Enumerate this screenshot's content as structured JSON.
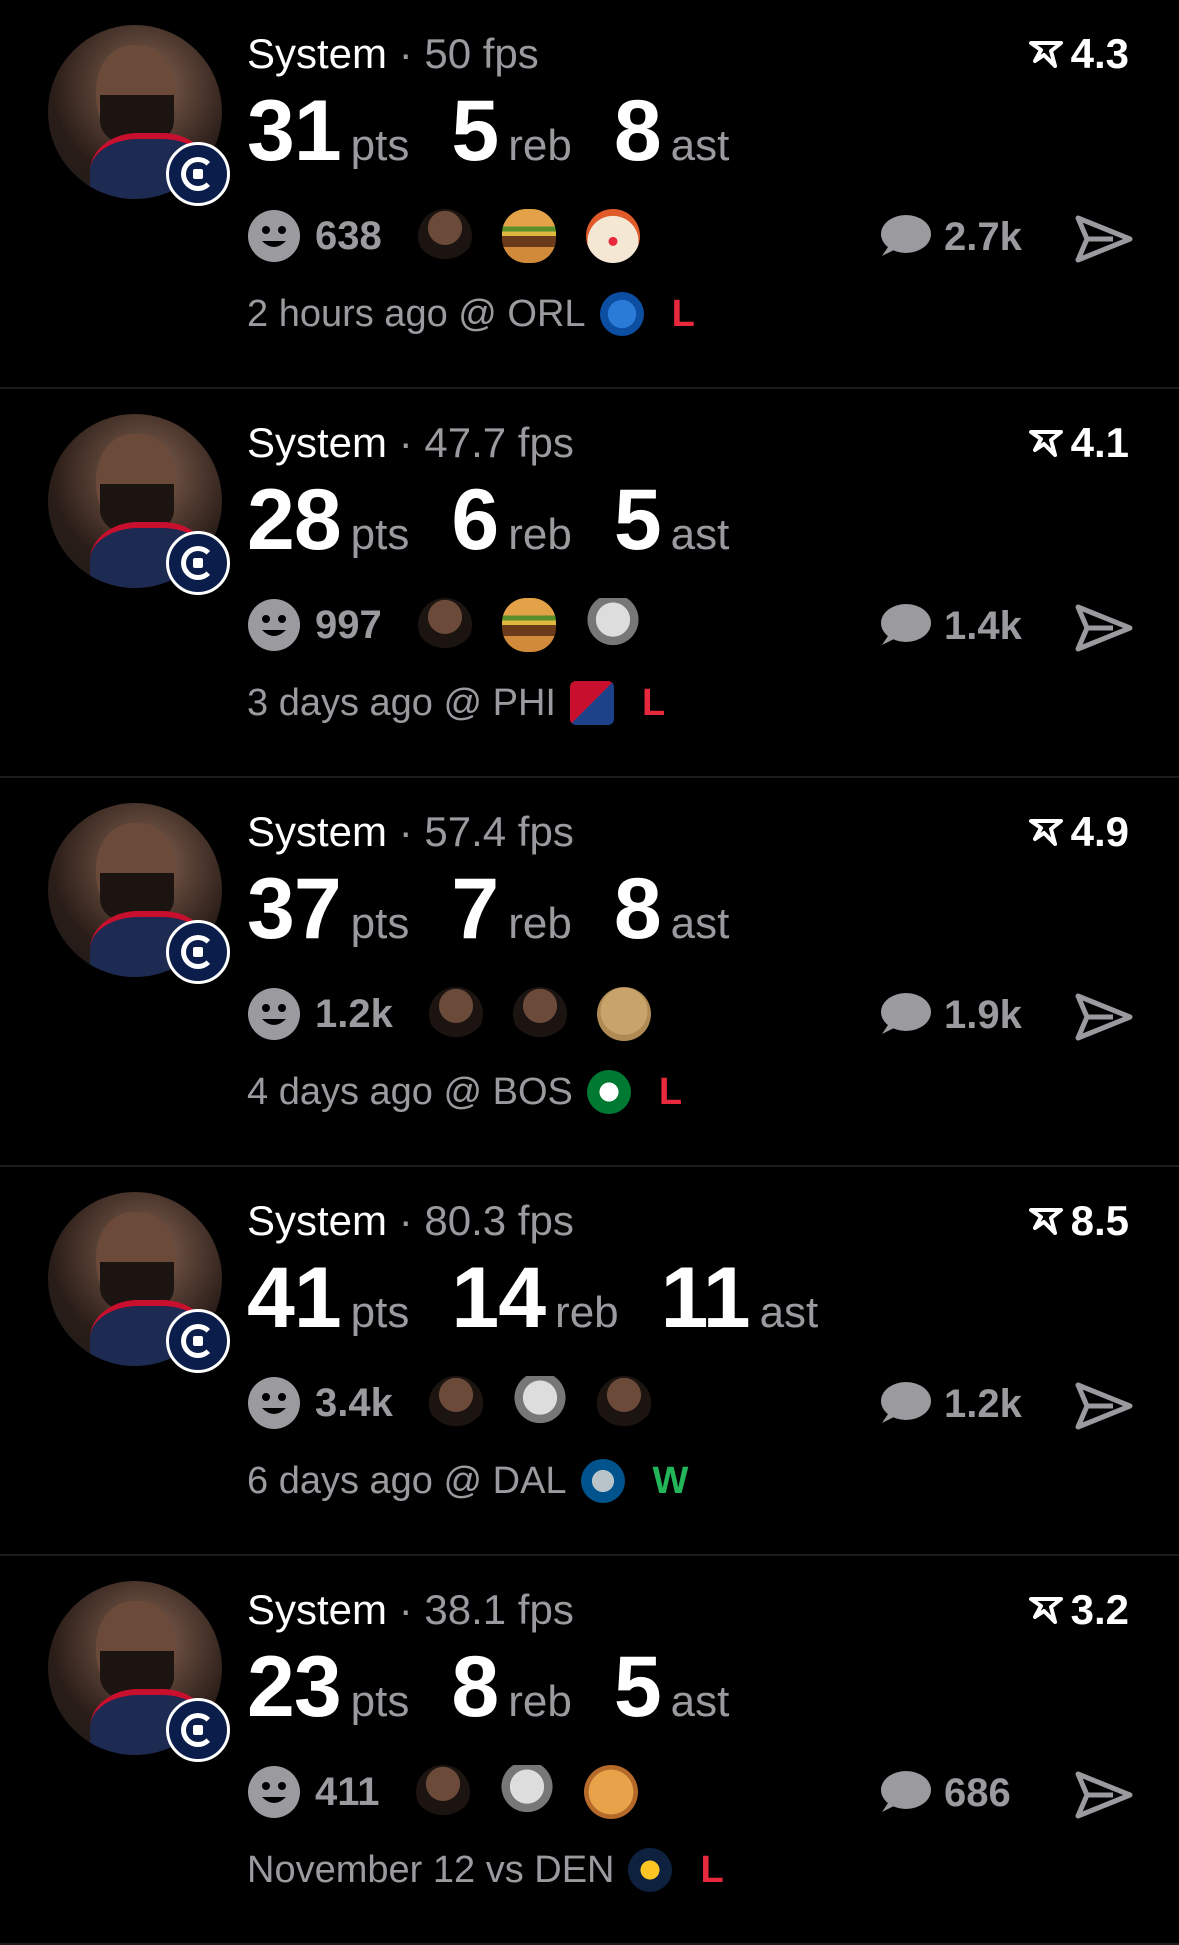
{
  "colors": {
    "background": "#000000",
    "primary_text": "#ffffff",
    "secondary_text": "#9a9a9f",
    "loss": "#e8283c",
    "win": "#22b559"
  },
  "posts": [
    {
      "author": "System",
      "separator": "·",
      "fps": "50 fps",
      "rating": "4.3",
      "stats": [
        {
          "value": "31",
          "unit": "pts"
        },
        {
          "value": "5",
          "unit": "reb"
        },
        {
          "value": "8",
          "unit": "ast"
        }
      ],
      "reaction_count": "638",
      "reaction_emojis": [
        "harden-face-icon",
        "burger-icon",
        "clown-icon"
      ],
      "comment_count": "2.7k",
      "time": "2 hours ago",
      "venue": "@",
      "opponent": "ORL",
      "opponent_logo": "magic-logo",
      "result": "L"
    },
    {
      "author": "System",
      "separator": "·",
      "fps": "47.7 fps",
      "rating": "4.1",
      "stats": [
        {
          "value": "28",
          "unit": "pts"
        },
        {
          "value": "6",
          "unit": "reb"
        },
        {
          "value": "5",
          "unit": "ast"
        }
      ],
      "reaction_count": "997",
      "reaction_emojis": [
        "harden-face-icon",
        "burger-icon",
        "goat-icon"
      ],
      "comment_count": "1.4k",
      "time": "3 days ago",
      "venue": "@",
      "opponent": "PHI",
      "opponent_logo": "76ers-logo",
      "result": "L"
    },
    {
      "author": "System",
      "separator": "·",
      "fps": "57.4 fps",
      "rating": "4.9",
      "stats": [
        {
          "value": "37",
          "unit": "pts"
        },
        {
          "value": "7",
          "unit": "reb"
        },
        {
          "value": "8",
          "unit": "ast"
        }
      ],
      "reaction_count": "1.2k",
      "reaction_emojis": [
        "harden-face-icon",
        "harden-face-icon",
        "old-man-icon"
      ],
      "comment_count": "1.9k",
      "time": "4 days ago",
      "venue": "@",
      "opponent": "BOS",
      "opponent_logo": "celtics-logo",
      "result": "L"
    },
    {
      "author": "System",
      "separator": "·",
      "fps": "80.3 fps",
      "rating": "8.5",
      "stats": [
        {
          "value": "41",
          "unit": "pts"
        },
        {
          "value": "14",
          "unit": "reb"
        },
        {
          "value": "11",
          "unit": "ast"
        }
      ],
      "reaction_count": "3.4k",
      "reaction_emojis": [
        "harden-face-icon",
        "goat-icon",
        "harden-face-icon"
      ],
      "comment_count": "1.2k",
      "time": "6 days ago",
      "venue": "@",
      "opponent": "DAL",
      "opponent_logo": "mavericks-logo",
      "result": "W"
    },
    {
      "author": "System",
      "separator": "·",
      "fps": "38.1 fps",
      "rating": "3.2",
      "stats": [
        {
          "value": "23",
          "unit": "pts"
        },
        {
          "value": "8",
          "unit": "reb"
        },
        {
          "value": "5",
          "unit": "ast"
        }
      ],
      "reaction_count": "411",
      "reaction_emojis": [
        "harden-face-icon",
        "goat-icon",
        "person-face-icon"
      ],
      "comment_count": "686",
      "time": "November 12",
      "venue": "vs",
      "opponent": "DEN",
      "opponent_logo": "nuggets-logo",
      "result": "L"
    }
  ]
}
